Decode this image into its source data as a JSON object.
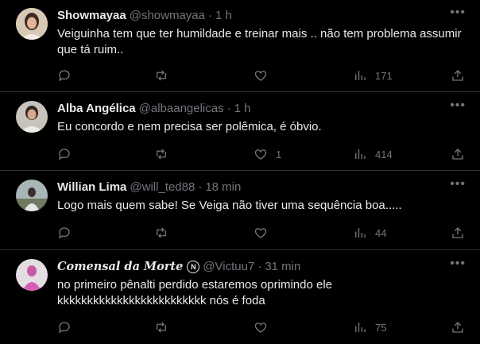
{
  "tweets": [
    {
      "name": "Showmayaa",
      "handle": "@showmayaa",
      "time": "1 h",
      "text": "Veiguinha tem que ter humildade e treinar mais .. não tem problema assumir\nque tá ruim..",
      "replies": "",
      "retweets": "",
      "likes": "",
      "views": "171",
      "avatar_color": "#c9b9a8"
    },
    {
      "name": "Alba Angélica",
      "handle": "@albaangelicas",
      "time": "1 h",
      "text": "Eu concordo e nem precisa ser polêmica, é óbvio.",
      "replies": "",
      "retweets": "",
      "likes": "1",
      "views": "414",
      "avatar_color": "#b8b4ae"
    },
    {
      "name": "Willian Lima",
      "handle": "@will_ted88",
      "time": "18 min",
      "text": "Logo mais quem sabe! Se Veiga não tiver uma sequência boa.....",
      "replies": "",
      "retweets": "",
      "likes": "",
      "views": "44",
      "avatar_color": "#8fa3a8"
    },
    {
      "name": "Comensal da Morte",
      "name_badge": "N",
      "handle": "@Victuu7",
      "time": "31 min",
      "text": "no primeiro pênalti perdido estaremos oprimindo ele\nkkkkkkkkkkkkkkkkkkkkkkkkk nós é foda",
      "replies": "",
      "retweets": "",
      "likes": "",
      "views": "75",
      "avatar_color": "#d9cfd6"
    }
  ],
  "separator": "·",
  "more_icon": "more-icon"
}
